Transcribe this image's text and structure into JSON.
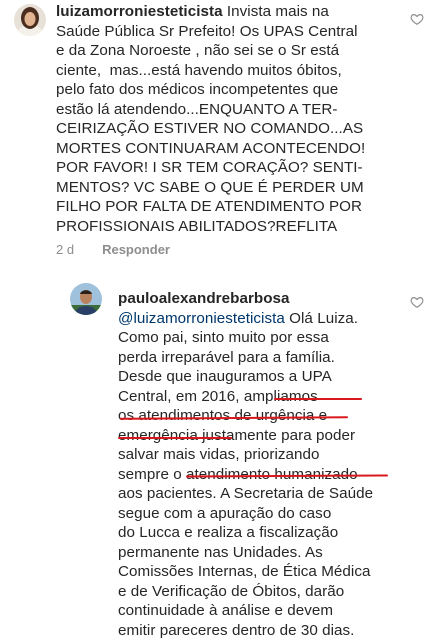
{
  "comment1": {
    "username": "luizamorroniesteticista",
    "lines": [
      "Invista mais na",
      "Saúde Pública Sr Prefeito! Os UPAS Central",
      "e da Zona Noroeste , não sei se o Sr está",
      "ciente,  mas...está havendo muitos óbitos,",
      "pelo fato dos médicos incompetentes que",
      "estão lá atendendo...ENQUANTO A TER-",
      "CEIRIZAÇÃO ESTIVER NO COMANDO...AS",
      "MORTES CONTINUARAM ACONTECENDO!",
      "POR FAVOR! I SR TEM CORAÇÃO? SENTI-",
      "MENTOS? VC SABE O QUE É PERDER UM",
      "FILHO POR FALTA DE ATENDIMENTO POR",
      "PROFISSIONAIS ABILITADOS?REFLITA"
    ],
    "time": "2 d",
    "reply_label": "Responder",
    "like_icon": "heart-outline-icon"
  },
  "comment2": {
    "username": "pauloalexandrebarbosa",
    "mention": "@luizamorroniesteticista",
    "after_mention": " Olá Luiza.",
    "lines": [
      "Como pai, sinto muito por essa",
      "perda irreparável para a família.",
      "Desde que inauguramos a UPA",
      "Central, em 2016, ampliamos",
      "os atendimentos de urgência e",
      "emergência justamente para poder",
      "salvar mais vidas, priorizando",
      "sempre o atendimento humanizado",
      "aos pacientes. A Secretaria de Saúde",
      "segue com a apuração do caso",
      "do Lucca e realiza a fiscalização",
      "permanente nas Unidades. As",
      "Comissões Internas, de Ética Médica",
      "e de Verificação de Óbitos, darão",
      "continuidade à análise e devem",
      "emitir pareceres dentro de 30 dias."
    ],
    "like_icon": "heart-outline-icon",
    "highlight_color": "#d9181e"
  }
}
